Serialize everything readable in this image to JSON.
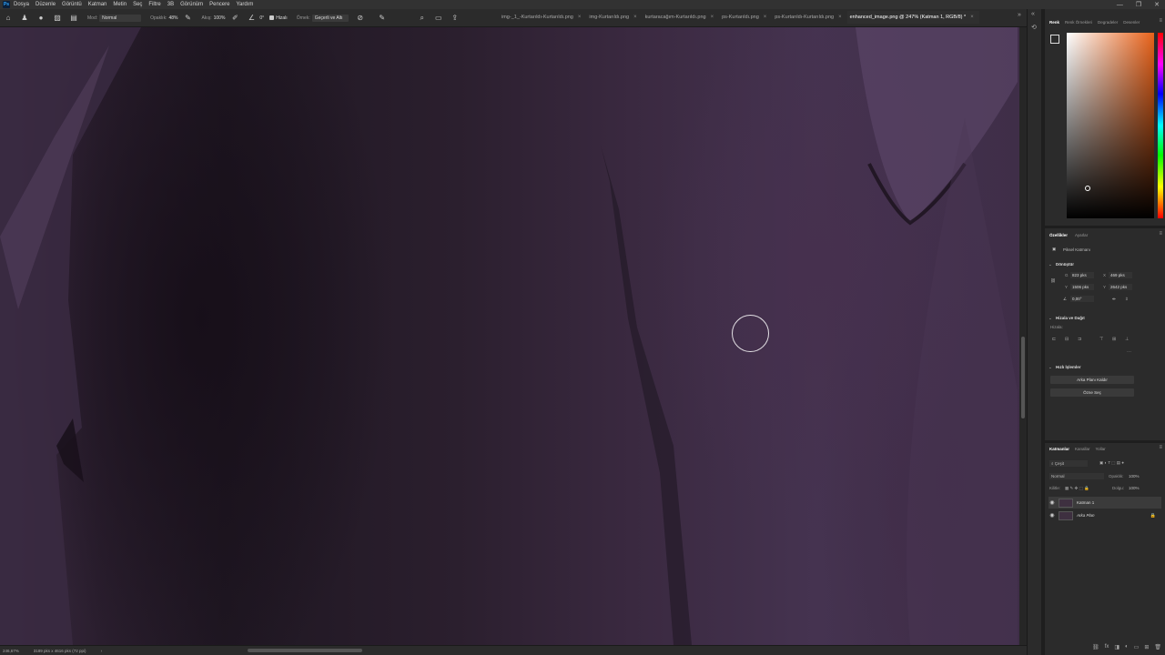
{
  "menubar": {
    "logo": "Ps",
    "items": [
      "Dosya",
      "Düzenle",
      "Görüntü",
      "Katman",
      "Metin",
      "Seç",
      "Filtre",
      "3B",
      "Görünüm",
      "Pencere",
      "Yardım"
    ],
    "window_controls": [
      "—",
      "❐",
      "✕"
    ]
  },
  "options": {
    "mode_label": "Mod:",
    "mode_value": "Normal",
    "opacity_label": "Opaklık:",
    "opacity_value": "48%",
    "flow_label": "Akış:",
    "flow_value": "100%",
    "angle_value": "0°",
    "smoothing_label": "Hizalı",
    "sample_label": "Örnek:",
    "sample_value": "Geçerli ve Altı"
  },
  "tabs": [
    {
      "label": "img-_1_-Kurtarıldı-Kurtarıldı.png",
      "active": false
    },
    {
      "label": "img-Kurtarıldı.png",
      "active": false
    },
    {
      "label": "kurtaracağım-Kurtarıldı.png",
      "active": false
    },
    {
      "label": "ps-Kurtarıldı.png",
      "active": false
    },
    {
      "label": "ps-Kurtarıldı-Kurtarıldı.png",
      "active": false
    },
    {
      "label": "enhanced_image.png @ 247% (Katman 1, RGB/8) *",
      "active": true
    }
  ],
  "color_panel": {
    "tabs": [
      "Renk",
      "Renk Örnekleri",
      "Degradeler",
      "Desenler"
    ],
    "active_tab": "Renk",
    "hue_color": "#e8621a"
  },
  "properties": {
    "tabs": [
      "Özellikler",
      "Ayarlar"
    ],
    "active_tab": "Özellikler",
    "layer_type": "Piksel Katmanı",
    "transform_title": "Dönüştür",
    "w_label": "G",
    "w_value": "823 pks",
    "x_label": "X",
    "x_value": "469 pks",
    "h_label": "Y",
    "h_value": "1506 pks",
    "y_label": "Y",
    "y_value": "2642 pks",
    "angle_value": "0,00°",
    "align_title": "Hizala ve Dağıt",
    "align_sub": "Hizala:",
    "quick_title": "Hızlı İşlemler",
    "btn_remove_bg": "Arka Planı Kaldır",
    "btn_select_subject": "Özne Seç"
  },
  "layers": {
    "tabs": [
      "Katmanlar",
      "Kanallar",
      "Yollar"
    ],
    "active_tab": "Katmanlar",
    "search_label": "Çeşit",
    "blend_mode": "Normal",
    "opacity_label": "Opaklık:",
    "opacity_value": "100%",
    "lock_label": "Kilitle:",
    "fill_label": "Dolgu:",
    "fill_value": "100%",
    "items": [
      {
        "name": "Katman 1",
        "selected": true,
        "locked": false
      },
      {
        "name": "Arka Plan",
        "selected": false,
        "locked": true
      }
    ]
  },
  "status": {
    "zoom": "246,67%",
    "doc_size": "3189 pks x 4616 pks (72 ppi)"
  }
}
